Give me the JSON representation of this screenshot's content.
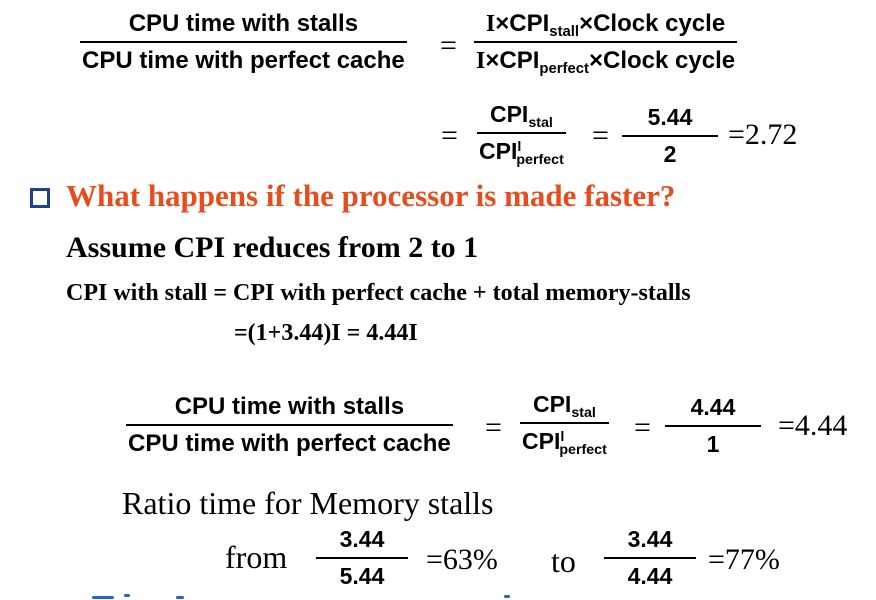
{
  "eq1": {
    "num": "CPU time with stalls",
    "den": "CPU time with perfect cache",
    "rhs_num": {
      "a": "I",
      "x1": "×",
      "b": "CPI",
      "sub": "stall",
      "x2": "×",
      "c": "Clock cycle"
    },
    "rhs_den": {
      "a": "I",
      "x1": "×",
      "b": "CPI",
      "sub": "perfect",
      "x2": "×",
      "c": "Clock cycle"
    },
    "equals": "="
  },
  "eq2": {
    "equals1": "=",
    "f1_num": {
      "b": "CPI",
      "sub": "stal"
    },
    "f1_den": {
      "b": "CPI",
      "sup": "l",
      "sub": "perfect"
    },
    "equals2": "=",
    "f2_num": "5.44",
    "f2_den": "2",
    "result": "=2.72"
  },
  "bullet": {
    "question": "What happens if the processor is made faster?",
    "color": "#e84c1c",
    "box_color": "#1f3f8f"
  },
  "assume": "Assume CPI reduces from 2 to 1",
  "cpi_line": "CPI with stall = CPI with perfect cache + total memory-stalls",
  "cpi_calc": "=(1+3.44)I = 4.44I",
  "eq3": {
    "num": "CPU time with stalls",
    "den": "CPU time with perfect cache",
    "equals1": "=",
    "f1_num": {
      "b": "CPI",
      "sub": "stal"
    },
    "f1_den": {
      "b": "CPI",
      "sup": "l",
      "sub": "perfect"
    },
    "equals2": "=",
    "f2_num": "4.44",
    "f2_den": "1",
    "result": "=4.44"
  },
  "ratio": {
    "heading": "Ratio time for Memory stalls",
    "from": "from",
    "from_num": "3.44",
    "from_den": "5.44",
    "from_result": "=63%",
    "to": "to",
    "to_num": "3.44",
    "to_den": "4.44",
    "to_result": "=77%"
  }
}
